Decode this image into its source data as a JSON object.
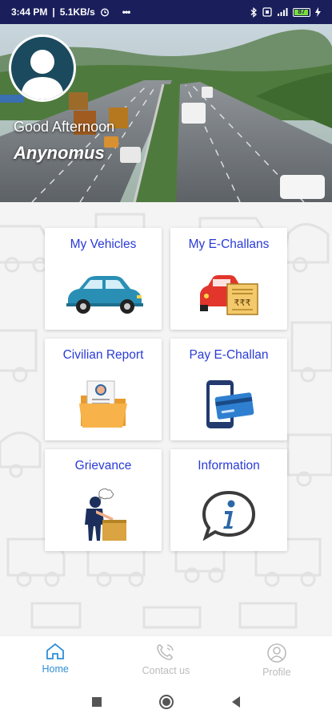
{
  "status_bar": {
    "time": "3:44 PM",
    "speed": "5.1KB/s",
    "more": "•••",
    "battery": "87"
  },
  "hero": {
    "greeting": "Good Afternoon",
    "username": "Anynomus"
  },
  "tiles": [
    {
      "label": "My Vehicles",
      "icon": "car-icon"
    },
    {
      "label": "My E-Challans",
      "icon": "challan-icon"
    },
    {
      "label": "Civilian Report",
      "icon": "report-folder-icon"
    },
    {
      "label": "Pay E-Challan",
      "icon": "phone-card-icon"
    },
    {
      "label": "Grievance",
      "icon": "grievance-icon"
    },
    {
      "label": "Information",
      "icon": "info-icon"
    }
  ],
  "bottom_nav": [
    {
      "label": "Home",
      "icon": "home-icon",
      "active": true
    },
    {
      "label": "Contact us",
      "icon": "phone-icon",
      "active": false
    },
    {
      "label": "Profile",
      "icon": "profile-icon",
      "active": false
    }
  ],
  "colors": {
    "status_bar": "#1a1f5c",
    "tile_text": "#2a3bd6",
    "nav_active": "#2f8fd6",
    "nav_inactive": "#bbbbbb"
  }
}
